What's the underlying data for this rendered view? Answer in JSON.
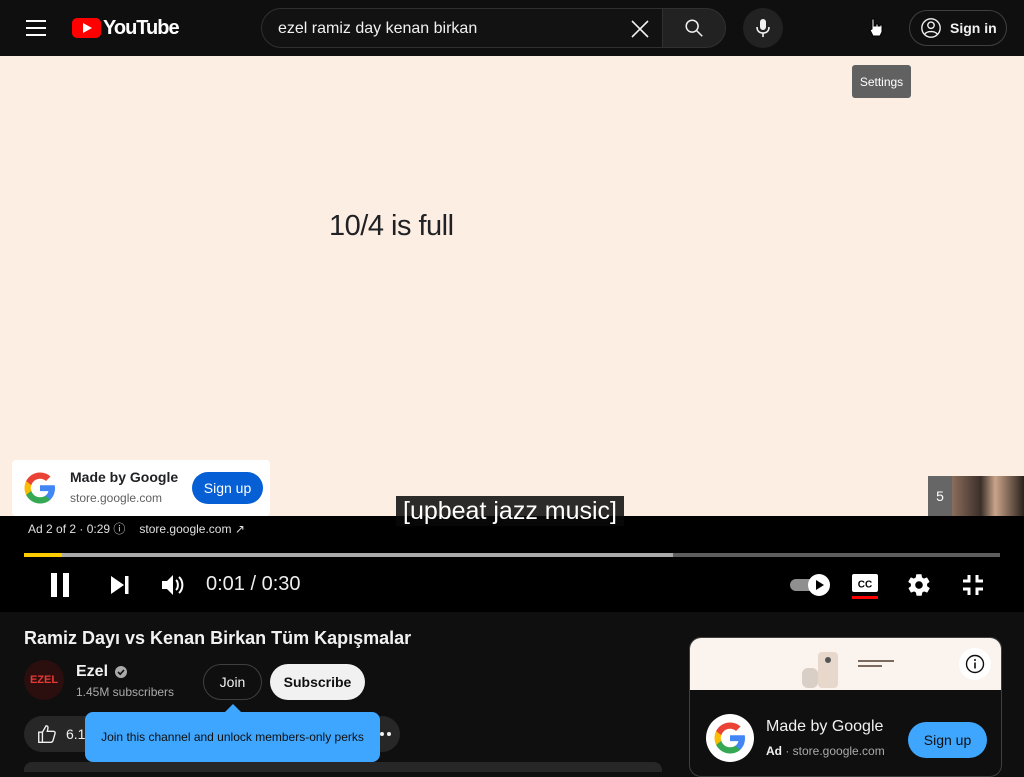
{
  "header": {
    "logo_text": "YouTube",
    "search_value": "ezel ramiz day kenan birkan",
    "signin_label": "Sign in",
    "settings_tooltip": "Settings"
  },
  "player": {
    "ad_headline": "10/4 is full",
    "ad_card": {
      "title": "Made by Google",
      "url": "store.google.com",
      "cta": "Sign up"
    },
    "ad_info": {
      "position": "Ad 2 of 2 · 0:29",
      "info_glyph": "ⓘ",
      "url": "store.google.com"
    },
    "caption": "[upbeat jazz music]",
    "up_next_count": "5",
    "progress": {
      "played_fraction": 0.039,
      "buffered_fraction": 0.665
    },
    "time": "0:01 / 0:30"
  },
  "video": {
    "title": "Ramiz Dayı vs Kenan Birkan Tüm Kapışmalar",
    "channel_name": "Ezel",
    "channel_avatar_text": "EZEL",
    "subscribers": "1.45M subscribers",
    "join_label": "Join",
    "subscribe_label": "Subscribe",
    "like_count": "6.1",
    "join_tooltip": "Join this channel and unlock members-only perks"
  },
  "side_ad": {
    "title": "Made by Google",
    "ad_label": "Ad",
    "separator": " · ",
    "url": "store.google.com",
    "cta": "Sign up"
  },
  "colors": {
    "accent_red": "#ff0000",
    "progress_played": "#ffcc00",
    "signup_blue": "#065fd4",
    "side_signup_blue": "#3ea6ff",
    "tooltip_blue": "#3ea6ff",
    "ad_background": "#fdeee4"
  }
}
